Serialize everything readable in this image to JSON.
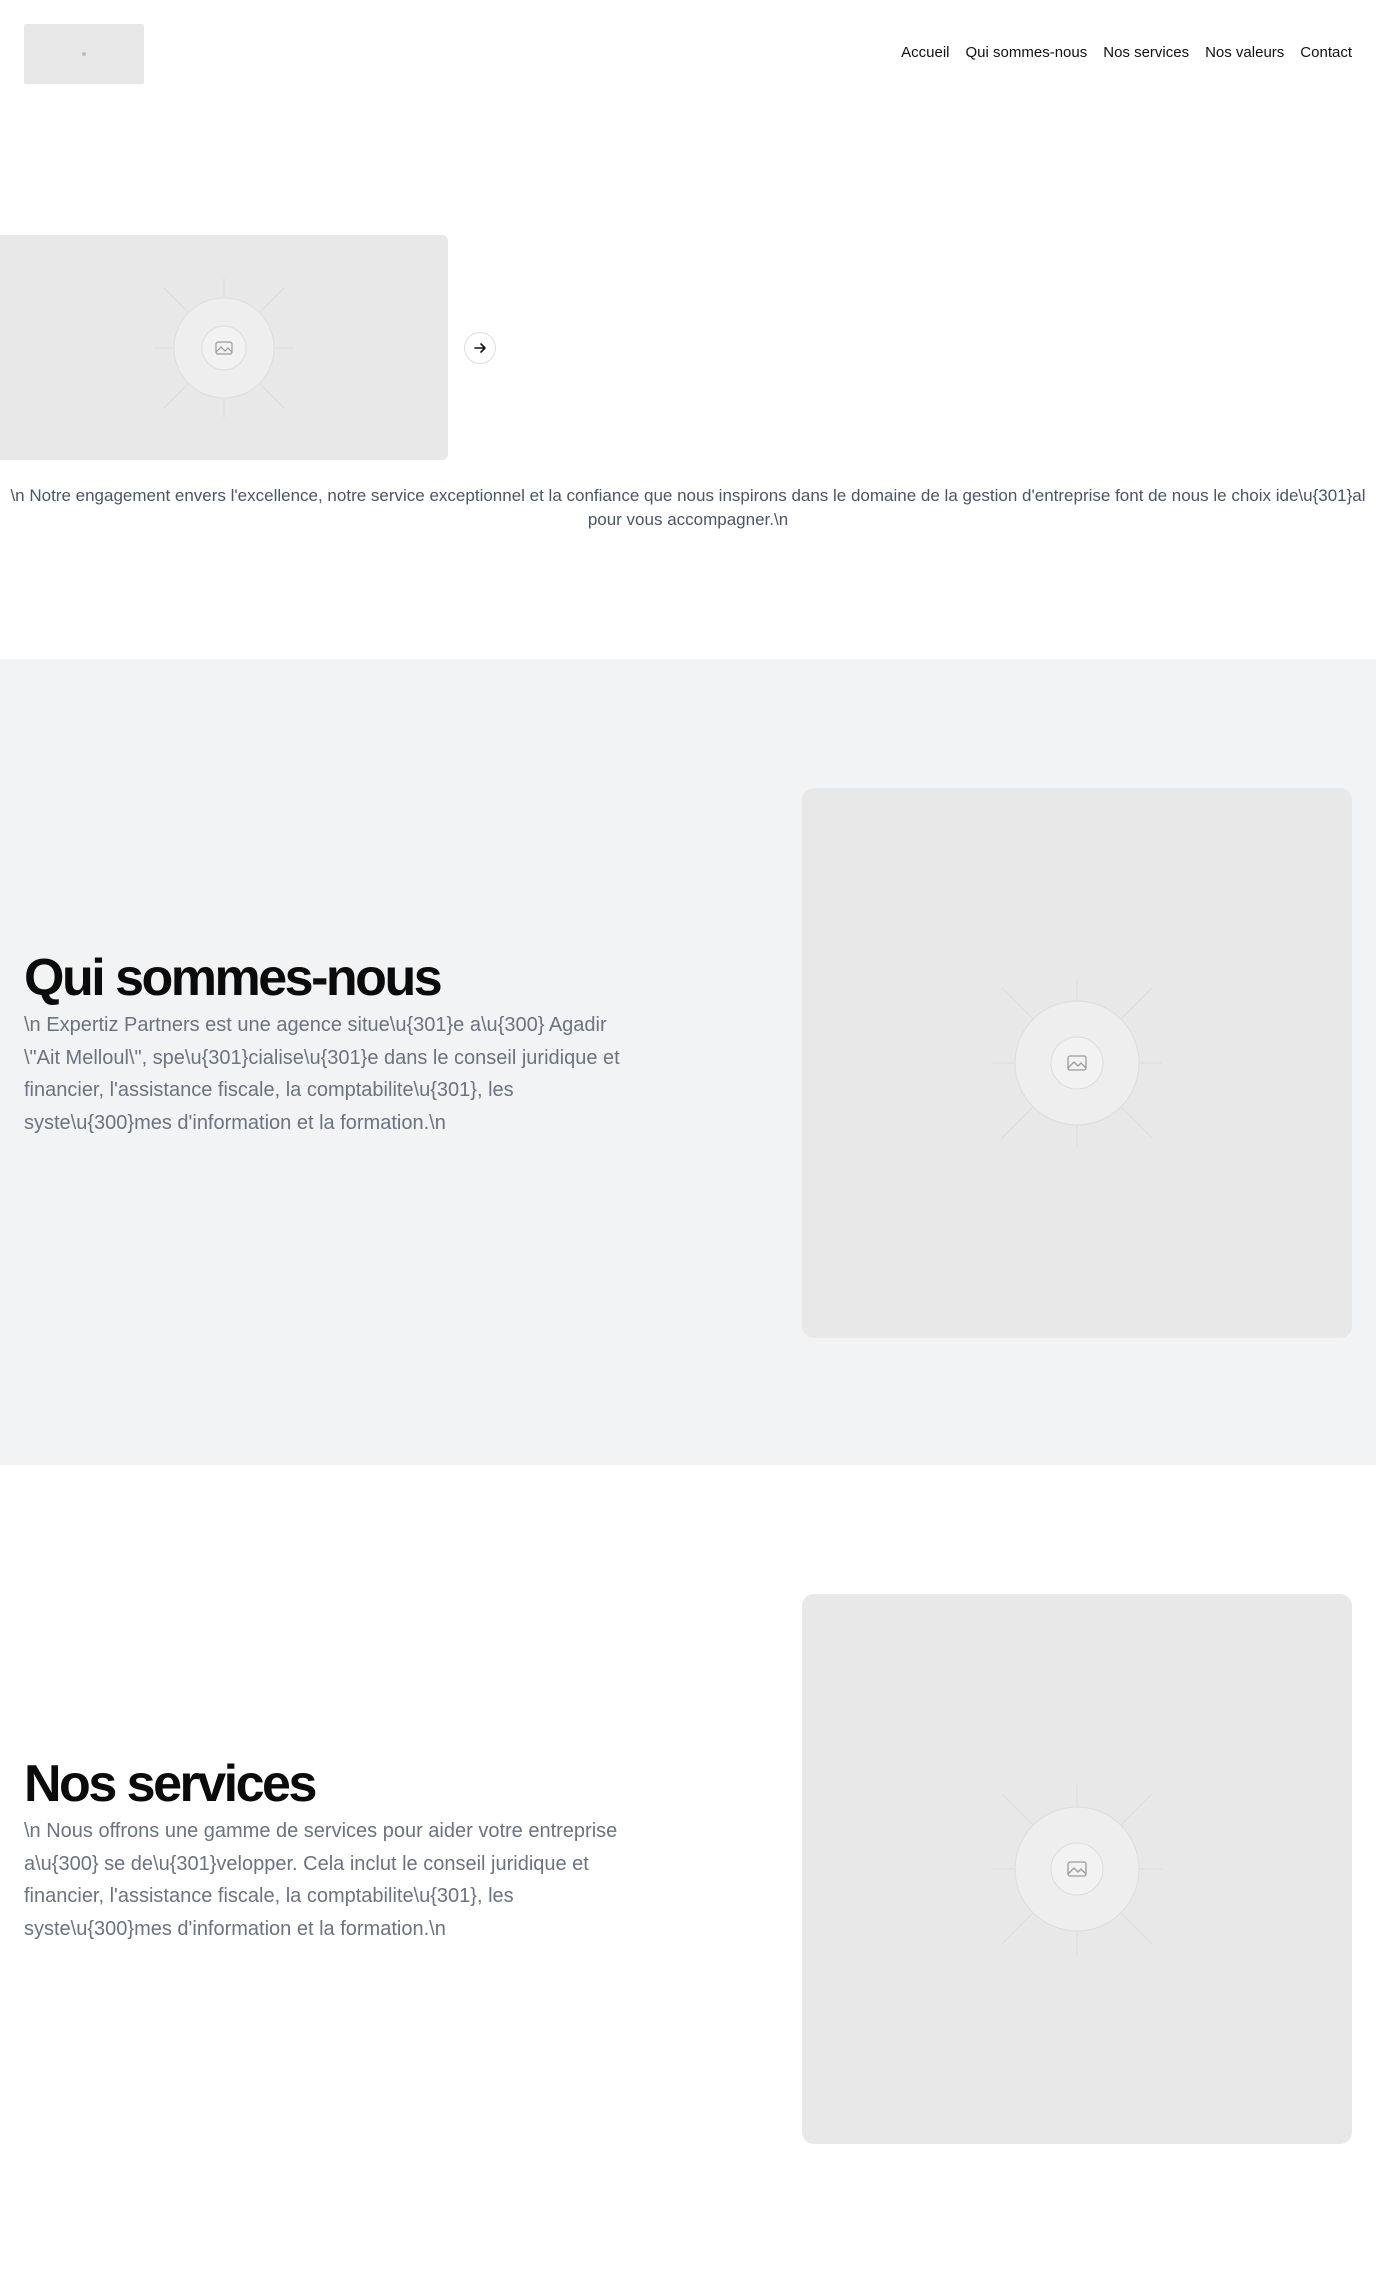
{
  "header": {
    "logo_icon": "image-placeholder-icon",
    "nav": [
      {
        "label": "Accueil"
      },
      {
        "label": "Qui sommes-nous"
      },
      {
        "label": "Nos services"
      },
      {
        "label": "Nos valeurs"
      },
      {
        "label": "Contact"
      }
    ]
  },
  "hero": {
    "image_icon": "image-placeholder-icon",
    "next_icon": "arrow-right-icon",
    "text": "\\n Notre engagement envers l'excellence, notre service exceptionnel et la confiance que nous inspirons dans le domaine de la gestion d'entreprise font de nous le choix ide\\u{301}al pour vous accompagner.\\n"
  },
  "about": {
    "title": "Qui sommes-nous",
    "text": "\\n Expertiz Partners est une agence situe\\u{301}e a\\u{300} Agadir \\\"Ait Melloul\\\", spe\\u{301}cialise\\u{301}e dans le conseil juridique et financier, l'assistance fiscale, la comptabilite\\u{301}, les syste\\u{300}mes d'information et la formation.\\n"
  },
  "services": {
    "title": "Nos services",
    "text": "\\n Nous offrons une gamme de services pour aider votre entreprise a\\u{300} se de\\u{301}velopper. Cela inclut le conseil juridique et financier, l'assistance fiscale, la comptabilite\\u{301}, les syste\\u{300}mes d'information et la formation.\\n"
  },
  "colors": {
    "background": "#ffffff",
    "section_gray": "#f2f3f5",
    "placeholder": "#e8e8e8",
    "body_text": "#6b7280",
    "heading": "#0b0b0b"
  }
}
